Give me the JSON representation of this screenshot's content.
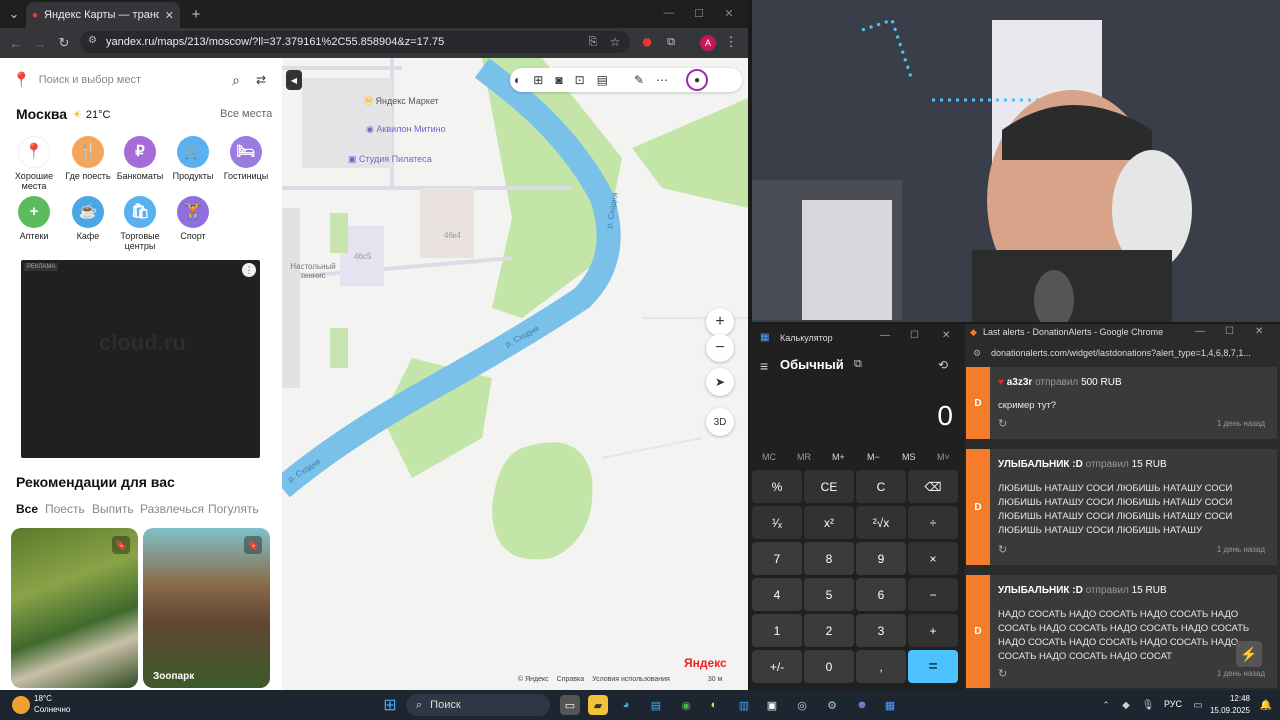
{
  "browser": {
    "tab_title": "Яндекс Карты — транспорт, н...",
    "url": "yandex.ru/maps/213/moscow/?ll=37.379161%2C55.858904&z=17.75",
    "profile_initial": "A"
  },
  "yandex": {
    "search_placeholder": "Поиск и выбор мест",
    "city": "Москва",
    "temperature": "21°C",
    "all_places": "Все места",
    "categories": [
      {
        "label": "Хорошие места",
        "color": "#ffffff",
        "glyph": "📍"
      },
      {
        "label": "Где поесть",
        "color": "#f5a55a",
        "glyph": "🍴"
      },
      {
        "label": "Банкоматы",
        "color": "#a66bd9",
        "glyph": "₽"
      },
      {
        "label": "Продукты",
        "color": "#5ab1ef",
        "glyph": "🛒"
      },
      {
        "label": "Гостиницы",
        "color": "#9b7be0",
        "glyph": "🛏"
      },
      {
        "label": "Аптеки",
        "color": "#5cbc5c",
        "glyph": "+"
      },
      {
        "label": "Кафе",
        "color": "#49a7e8",
        "glyph": "☕"
      },
      {
        "label": "Торговые центры",
        "color": "#5ab1ef",
        "glyph": "🛍"
      },
      {
        "label": "Спорт",
        "color": "#8f6ee0",
        "glyph": "🏋"
      }
    ],
    "ad_label": "РЕКЛАМА",
    "ad_brand": "cloud.ru",
    "recommendations_title": "Рекомендации для вас",
    "rec_tabs": [
      "Все",
      "Поесть",
      "Выпить",
      "Развлечься",
      "Погулять"
    ],
    "cards": [
      {
        "label": ""
      },
      {
        "label": "Зоопарк"
      }
    ]
  },
  "map": {
    "labels": {
      "market": "Яндекс Маркет",
      "akvilon": "Аквилон Митино",
      "pilates": "Студия Пилатеса",
      "b46k4": "46к4",
      "b46s5": "46с5",
      "tennis": "Настольный теннис",
      "river1": "р. Сходня",
      "river2": "р. Сходня",
      "river3": "р. Сходня"
    },
    "zoom_in": "+",
    "zoom_out": "−",
    "btn_3d": "3D",
    "copyright": "© Яндекс",
    "help": "Справка",
    "terms": "Условия использования",
    "scale": "30 м",
    "logo": "Яндекс"
  },
  "calculator": {
    "window_title": "Калькулятор",
    "mode": "Обычный",
    "display": "0",
    "memory": [
      "MC",
      "MR",
      "M+",
      "M−",
      "MS",
      "M˅"
    ],
    "keys": [
      [
        "%",
        "CE",
        "C",
        "⌫"
      ],
      [
        "¹⁄ₓ",
        "x²",
        "²√x",
        "÷"
      ],
      [
        "7",
        "8",
        "9",
        "×"
      ],
      [
        "4",
        "5",
        "6",
        "−"
      ],
      [
        "1",
        "2",
        "3",
        "+"
      ],
      [
        "+/-",
        "0",
        ",",
        "="
      ]
    ]
  },
  "donations": {
    "window_title": "Last alerts - DonationAlerts - Google Chrome",
    "url": "donationalerts.com/widget/lastdonations?alert_type=1,4,6,8,7,1...",
    "alerts": [
      {
        "user": "a3z3r",
        "verb": "отправил",
        "amount": "500 RUB",
        "message": "скример тут?",
        "time": "1 день назад"
      },
      {
        "user": "УЛЫБАЛЬНИК :D",
        "verb": "отправил",
        "amount": "15 RUB",
        "message": "ЛЮБИШЬ НАТАШУ СОСИ ЛЮБИШЬ НАТАШУ СОСИ ЛЮБИШЬ НАТАШУ СОСИ ЛЮБИШЬ НАТАШУ СОСИ ЛЮБИШЬ НАТАШУ СОСИ ЛЮБИШЬ НАТАШУ СОСИ ЛЮБИШЬ НАТАШУ СОСИ ЛЮБИШЬ НАТАШУ",
        "time": "1 день назад"
      },
      {
        "user": "УЛЫБАЛЬНИК :D",
        "verb": "отправил",
        "amount": "15 RUB",
        "message": "НАДО СОСАТЬ НАДО СОСАТЬ НАДО СОСАТЬ НАДО СОСАТЬ НАДО СОСАТЬ НАДО СОСАТЬ НАДО СОСАТЬ НАДО СОСАТЬ НАДО СОСАТЬ НАДО СОСАТЬ НАДО СОСАТЬ НАДО СОСАТЬ НАДО СОСАТ",
        "time": "1 день назад"
      }
    ]
  },
  "taskbar": {
    "weather_temp": "18°C",
    "weather_desc": "Солнечно",
    "search": "Поиск",
    "lang": "РУС",
    "time": "12:48",
    "date": "15.09.2025"
  }
}
